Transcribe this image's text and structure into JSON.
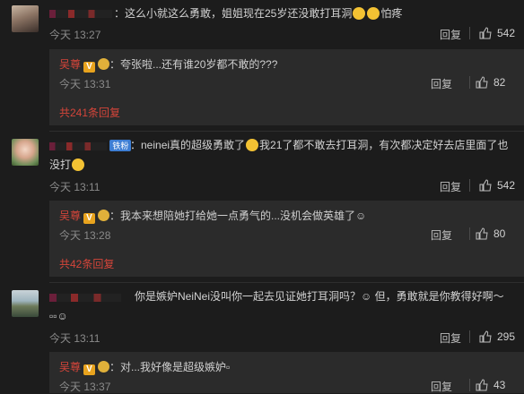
{
  "comments": [
    {
      "text": "：这么小就这么勇敢，姐姐现在25岁还没敢打耳洞",
      "text_tail": "怕疼",
      "time": "今天 13:27",
      "reply_label": "回复",
      "likes": "542",
      "reply": {
        "author": "吴尊",
        "text": "：夸张啦...还有谁20岁都不敢的???",
        "time": "今天 13:31",
        "reply_label": "回复",
        "likes": "82"
      },
      "more": "共241条回复"
    },
    {
      "badge": "铁粉",
      "text": "：neinei真的超级勇敢了",
      "text_mid": "我21了都不敢去打耳洞，有次都决定好去店里面了也",
      "text_line2": "没打",
      "time": "今天 13:11",
      "reply_label": "回复",
      "likes": "542",
      "reply": {
        "author": "吴尊",
        "text": "：我本来想陪她打给她一点勇气的...没机会做英雄了☺",
        "time": "今天 13:28",
        "reply_label": "回复",
        "likes": "80"
      },
      "more": "共42条回复"
    },
    {
      "text": "你是嫉妒NeiNei没叫你一起去见证她打耳洞吗？☺ 但，勇敢就是你教得好啊～",
      "text_line2": "▫▫☺",
      "time": "今天 13:11",
      "reply_label": "回复",
      "likes": "295",
      "reply": {
        "author": "吴尊",
        "text": "：对...我好像是超级嫉妒▫",
        "time": "今天 13:37",
        "reply_label": "回复",
        "likes": "43"
      }
    }
  ],
  "colors": {
    "background": "#1c1c1c",
    "reply_background": "#2b2b2b",
    "author_red": "#d5453a",
    "muted": "#8a8a8a"
  },
  "icons": {
    "like": "thumbs-up-icon",
    "verified": "v-badge-icon",
    "vip": "vip-badge-icon",
    "emoji": "laughing-emoji-icon"
  }
}
